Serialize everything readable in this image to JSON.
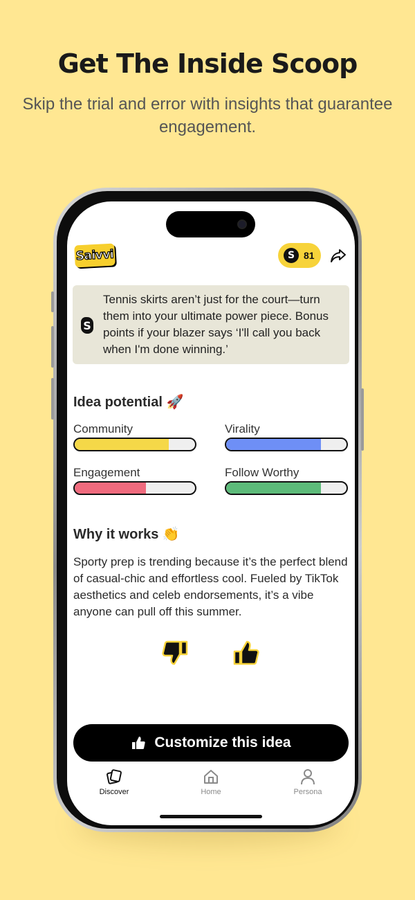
{
  "promo": {
    "headline": "Get The Inside Scoop",
    "subheadline": "Skip the trial and error with insights that guarantee engagement."
  },
  "app": {
    "logo_text": "Saivvi",
    "coins": {
      "icon": "s-coin-icon",
      "count": "81"
    },
    "share_icon": "share-arrow-icon",
    "tip": {
      "icon": "saivvi-s-icon",
      "text": "Tennis skirts aren’t just for the court—turn them into your ultimate power piece. Bonus points if your blazer says ‘I'll call you back when I'm done winning.’"
    },
    "idea_potential": {
      "title": "Idea potential 🚀",
      "metrics": [
        {
          "label": "Community",
          "value": 0.78,
          "color": "#F5D848"
        },
        {
          "label": "Virality",
          "value": 0.79,
          "color": "#6E8FF6"
        },
        {
          "label": "Engagement",
          "value": 0.59,
          "color": "#F06B7E"
        },
        {
          "label": "Follow Worthy",
          "value": 0.79,
          "color": "#5DBB7A"
        }
      ]
    },
    "why_it_works": {
      "title": "Why it works 👏",
      "text": "Sporty prep is trending because it’s the perfect blend of casual-chic and effortless cool. Fueled by TikTok aesthetics and celeb endorsements, it’s a vibe anyone can pull off this summer."
    },
    "feedback": {
      "dislike_icon": "thumbs-down-icon",
      "like_icon": "thumbs-up-icon"
    },
    "cta": {
      "label": "Customize this idea",
      "icon": "thumbs-up-icon"
    },
    "tabs": [
      {
        "label": "Discover",
        "icon": "cards-icon",
        "active": true
      },
      {
        "label": "Home",
        "icon": "house-icon",
        "active": false
      },
      {
        "label": "Persona",
        "icon": "person-icon",
        "active": false
      }
    ],
    "colors": {
      "accent": "#F7D33A",
      "background": "#FFE792",
      "active_tab": "#111111",
      "inactive_tab": "#8A8A8A"
    }
  }
}
